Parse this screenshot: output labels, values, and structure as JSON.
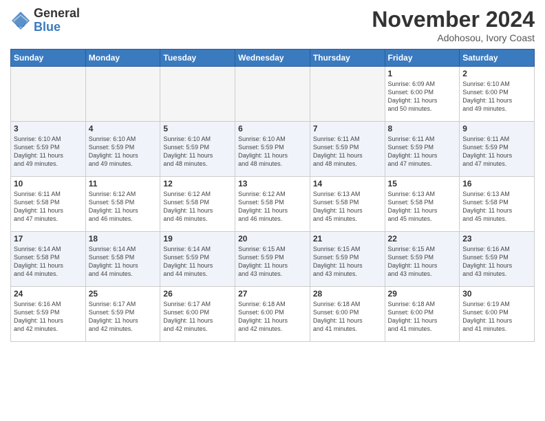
{
  "logo": {
    "general": "General",
    "blue": "Blue"
  },
  "header": {
    "month": "November 2024",
    "location": "Adohosou, Ivory Coast"
  },
  "weekdays": [
    "Sunday",
    "Monday",
    "Tuesday",
    "Wednesday",
    "Thursday",
    "Friday",
    "Saturday"
  ],
  "weeks": [
    [
      {
        "day": "",
        "info": ""
      },
      {
        "day": "",
        "info": ""
      },
      {
        "day": "",
        "info": ""
      },
      {
        "day": "",
        "info": ""
      },
      {
        "day": "",
        "info": ""
      },
      {
        "day": "1",
        "info": "Sunrise: 6:09 AM\nSunset: 6:00 PM\nDaylight: 11 hours\nand 50 minutes."
      },
      {
        "day": "2",
        "info": "Sunrise: 6:10 AM\nSunset: 6:00 PM\nDaylight: 11 hours\nand 49 minutes."
      }
    ],
    [
      {
        "day": "3",
        "info": "Sunrise: 6:10 AM\nSunset: 5:59 PM\nDaylight: 11 hours\nand 49 minutes."
      },
      {
        "day": "4",
        "info": "Sunrise: 6:10 AM\nSunset: 5:59 PM\nDaylight: 11 hours\nand 49 minutes."
      },
      {
        "day": "5",
        "info": "Sunrise: 6:10 AM\nSunset: 5:59 PM\nDaylight: 11 hours\nand 48 minutes."
      },
      {
        "day": "6",
        "info": "Sunrise: 6:10 AM\nSunset: 5:59 PM\nDaylight: 11 hours\nand 48 minutes."
      },
      {
        "day": "7",
        "info": "Sunrise: 6:11 AM\nSunset: 5:59 PM\nDaylight: 11 hours\nand 48 minutes."
      },
      {
        "day": "8",
        "info": "Sunrise: 6:11 AM\nSunset: 5:59 PM\nDaylight: 11 hours\nand 47 minutes."
      },
      {
        "day": "9",
        "info": "Sunrise: 6:11 AM\nSunset: 5:59 PM\nDaylight: 11 hours\nand 47 minutes."
      }
    ],
    [
      {
        "day": "10",
        "info": "Sunrise: 6:11 AM\nSunset: 5:58 PM\nDaylight: 11 hours\nand 47 minutes."
      },
      {
        "day": "11",
        "info": "Sunrise: 6:12 AM\nSunset: 5:58 PM\nDaylight: 11 hours\nand 46 minutes."
      },
      {
        "day": "12",
        "info": "Sunrise: 6:12 AM\nSunset: 5:58 PM\nDaylight: 11 hours\nand 46 minutes."
      },
      {
        "day": "13",
        "info": "Sunrise: 6:12 AM\nSunset: 5:58 PM\nDaylight: 11 hours\nand 46 minutes."
      },
      {
        "day": "14",
        "info": "Sunrise: 6:13 AM\nSunset: 5:58 PM\nDaylight: 11 hours\nand 45 minutes."
      },
      {
        "day": "15",
        "info": "Sunrise: 6:13 AM\nSunset: 5:58 PM\nDaylight: 11 hours\nand 45 minutes."
      },
      {
        "day": "16",
        "info": "Sunrise: 6:13 AM\nSunset: 5:58 PM\nDaylight: 11 hours\nand 45 minutes."
      }
    ],
    [
      {
        "day": "17",
        "info": "Sunrise: 6:14 AM\nSunset: 5:58 PM\nDaylight: 11 hours\nand 44 minutes."
      },
      {
        "day": "18",
        "info": "Sunrise: 6:14 AM\nSunset: 5:58 PM\nDaylight: 11 hours\nand 44 minutes."
      },
      {
        "day": "19",
        "info": "Sunrise: 6:14 AM\nSunset: 5:59 PM\nDaylight: 11 hours\nand 44 minutes."
      },
      {
        "day": "20",
        "info": "Sunrise: 6:15 AM\nSunset: 5:59 PM\nDaylight: 11 hours\nand 43 minutes."
      },
      {
        "day": "21",
        "info": "Sunrise: 6:15 AM\nSunset: 5:59 PM\nDaylight: 11 hours\nand 43 minutes."
      },
      {
        "day": "22",
        "info": "Sunrise: 6:15 AM\nSunset: 5:59 PM\nDaylight: 11 hours\nand 43 minutes."
      },
      {
        "day": "23",
        "info": "Sunrise: 6:16 AM\nSunset: 5:59 PM\nDaylight: 11 hours\nand 43 minutes."
      }
    ],
    [
      {
        "day": "24",
        "info": "Sunrise: 6:16 AM\nSunset: 5:59 PM\nDaylight: 11 hours\nand 42 minutes."
      },
      {
        "day": "25",
        "info": "Sunrise: 6:17 AM\nSunset: 5:59 PM\nDaylight: 11 hours\nand 42 minutes."
      },
      {
        "day": "26",
        "info": "Sunrise: 6:17 AM\nSunset: 6:00 PM\nDaylight: 11 hours\nand 42 minutes."
      },
      {
        "day": "27",
        "info": "Sunrise: 6:18 AM\nSunset: 6:00 PM\nDaylight: 11 hours\nand 42 minutes."
      },
      {
        "day": "28",
        "info": "Sunrise: 6:18 AM\nSunset: 6:00 PM\nDaylight: 11 hours\nand 41 minutes."
      },
      {
        "day": "29",
        "info": "Sunrise: 6:18 AM\nSunset: 6:00 PM\nDaylight: 11 hours\nand 41 minutes."
      },
      {
        "day": "30",
        "info": "Sunrise: 6:19 AM\nSunset: 6:00 PM\nDaylight: 11 hours\nand 41 minutes."
      }
    ]
  ]
}
